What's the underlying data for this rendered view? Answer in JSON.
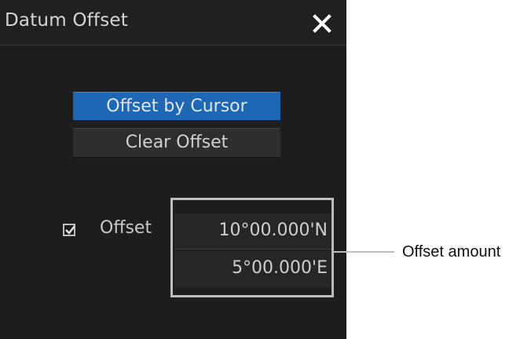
{
  "dialog": {
    "title": "Datum Offset",
    "close_icon": "close-icon",
    "buttons": {
      "offset_by_cursor": "Offset by Cursor",
      "clear_offset": "Clear Offset"
    },
    "offset": {
      "checkbox_checked": true,
      "label": "Offset",
      "latitude": "10°00.000'N",
      "longitude": "5°00.000'E"
    }
  },
  "annotation": {
    "callout": "Offset amount"
  },
  "colors": {
    "dialog_bg": "#1d1d1d",
    "active_button": "#1e67b4",
    "button_bg": "#2e2e2e",
    "text": "#d0d0d0",
    "highlight": "#bdbdbd"
  }
}
